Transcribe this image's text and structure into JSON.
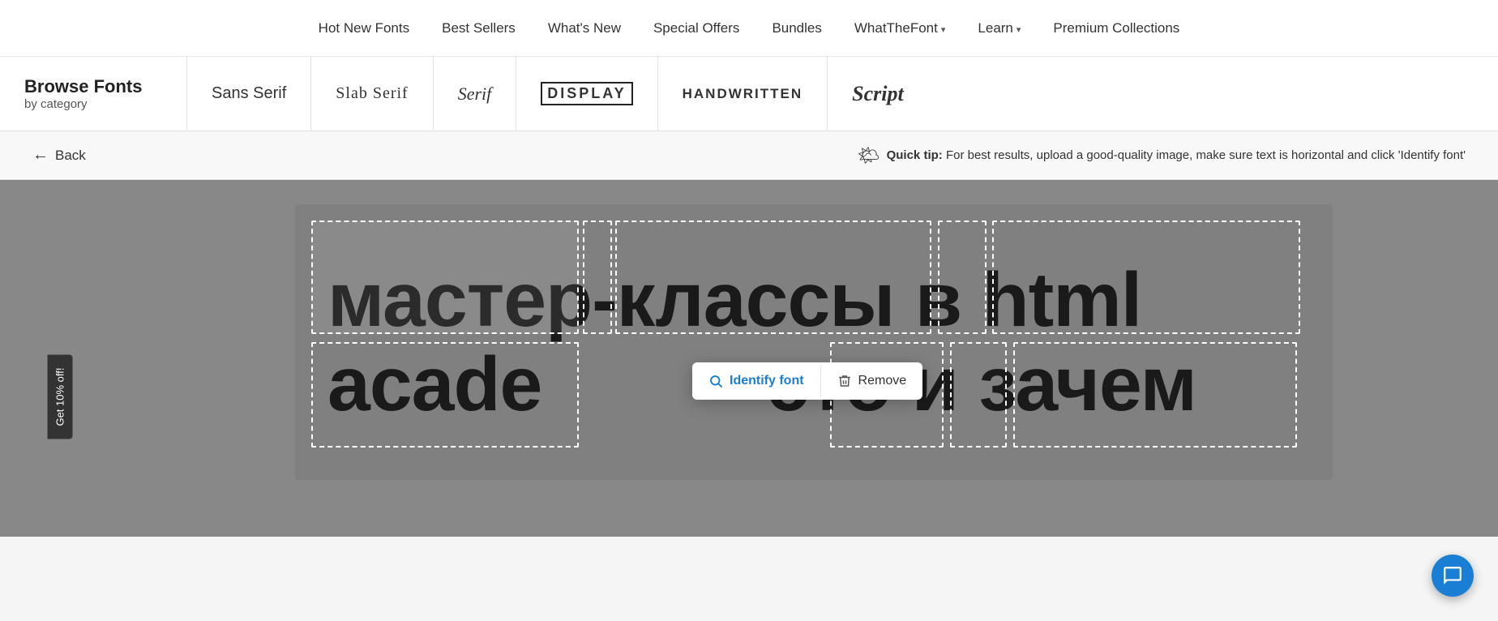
{
  "nav": {
    "items": [
      {
        "label": "Hot New Fonts",
        "href": "#",
        "dropdown": false
      },
      {
        "label": "Best Sellers",
        "href": "#",
        "dropdown": false
      },
      {
        "label": "What's New",
        "href": "#",
        "dropdown": false
      },
      {
        "label": "Special Offers",
        "href": "#",
        "dropdown": false
      },
      {
        "label": "Bundles",
        "href": "#",
        "dropdown": false
      },
      {
        "label": "WhatTheFont",
        "href": "#",
        "dropdown": true
      },
      {
        "label": "Learn",
        "href": "#",
        "dropdown": true
      },
      {
        "label": "Premium Collections",
        "href": "#",
        "dropdown": false
      }
    ]
  },
  "category_bar": {
    "browse_title": "Browse Fonts",
    "browse_subtitle": "by category",
    "categories": [
      {
        "label": "Sans Serif",
        "style_class": "cat-sans"
      },
      {
        "label": "Slab Serif",
        "style_class": "cat-slab"
      },
      {
        "label": "Serif",
        "style_class": "cat-serif"
      },
      {
        "label": "DISPLAY",
        "style_class": "cat-display"
      },
      {
        "label": "HANDWRITTEN",
        "style_class": "cat-handwritten"
      },
      {
        "label": "Script",
        "style_class": "cat-script"
      }
    ]
  },
  "back_bar": {
    "back_label": "Back",
    "quick_tip_prefix": "Quick tip:",
    "quick_tip_text": " For best results, upload a good-quality image, make sure text is horizontal and click 'Identify font'"
  },
  "canvas": {
    "promo_label": "Get 10% off!",
    "text_line1": "мастер-классы в html",
    "text_line2": "acade                это и зачем"
  },
  "popup": {
    "identify_label": "Identify font",
    "remove_label": "Remove"
  },
  "chat": {
    "aria_label": "Chat support"
  }
}
